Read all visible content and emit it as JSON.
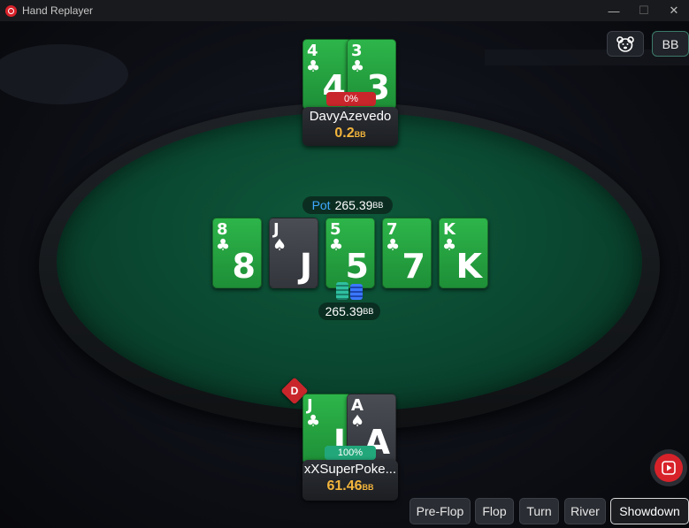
{
  "window": {
    "title": "Hand Replayer",
    "minimize_glyph": "—",
    "maximize_glyph": "☐",
    "close_glyph": "✕"
  },
  "header_buttons": {
    "emoji_icon": "bear-face-icon",
    "bb_label": "BB"
  },
  "top_player": {
    "name": "DavyAzevedo",
    "stack_value": "0.2",
    "stack_unit": "BB",
    "equity": "0%",
    "cards": [
      {
        "rank": "4",
        "suit": "♣",
        "suit_name": "club"
      },
      {
        "rank": "3",
        "suit": "♣",
        "suit_name": "club"
      }
    ]
  },
  "board": {
    "pot_label": "Pot",
    "pot_value": "265.39",
    "pot_unit": "BB",
    "cards": [
      {
        "rank": "8",
        "suit": "♣",
        "suit_name": "club"
      },
      {
        "rank": "J",
        "suit": "♠",
        "suit_name": "spade"
      },
      {
        "rank": "5",
        "suit": "♣",
        "suit_name": "club"
      },
      {
        "rank": "7",
        "suit": "♣",
        "suit_name": "club"
      },
      {
        "rank": "K",
        "suit": "♣",
        "suit_name": "club"
      }
    ],
    "bet_value": "265.39",
    "bet_unit": "BB"
  },
  "dealer_button": "D",
  "hero_player": {
    "name": "xXSuperPoke...",
    "stack_value": "61.46",
    "stack_unit": "BB",
    "equity": "100%",
    "cards": [
      {
        "rank": "J",
        "suit": "♣",
        "suit_name": "club"
      },
      {
        "rank": "A",
        "suit": "♠",
        "suit_name": "spade"
      }
    ]
  },
  "controls": {
    "streets": [
      "Pre-Flop",
      "Flop",
      "Turn",
      "River",
      "Showdown"
    ],
    "active_street": "Showdown",
    "play_icon": "play-icon"
  },
  "colors": {
    "felt": "#0a4630",
    "club_card": "#2db54a",
    "spade_card": "#3a3d43",
    "stack_gold": "#f3b53c",
    "pot_blue": "#3fa9ff",
    "accent_red": "#d8222a",
    "equity_green": "#22a77a"
  }
}
